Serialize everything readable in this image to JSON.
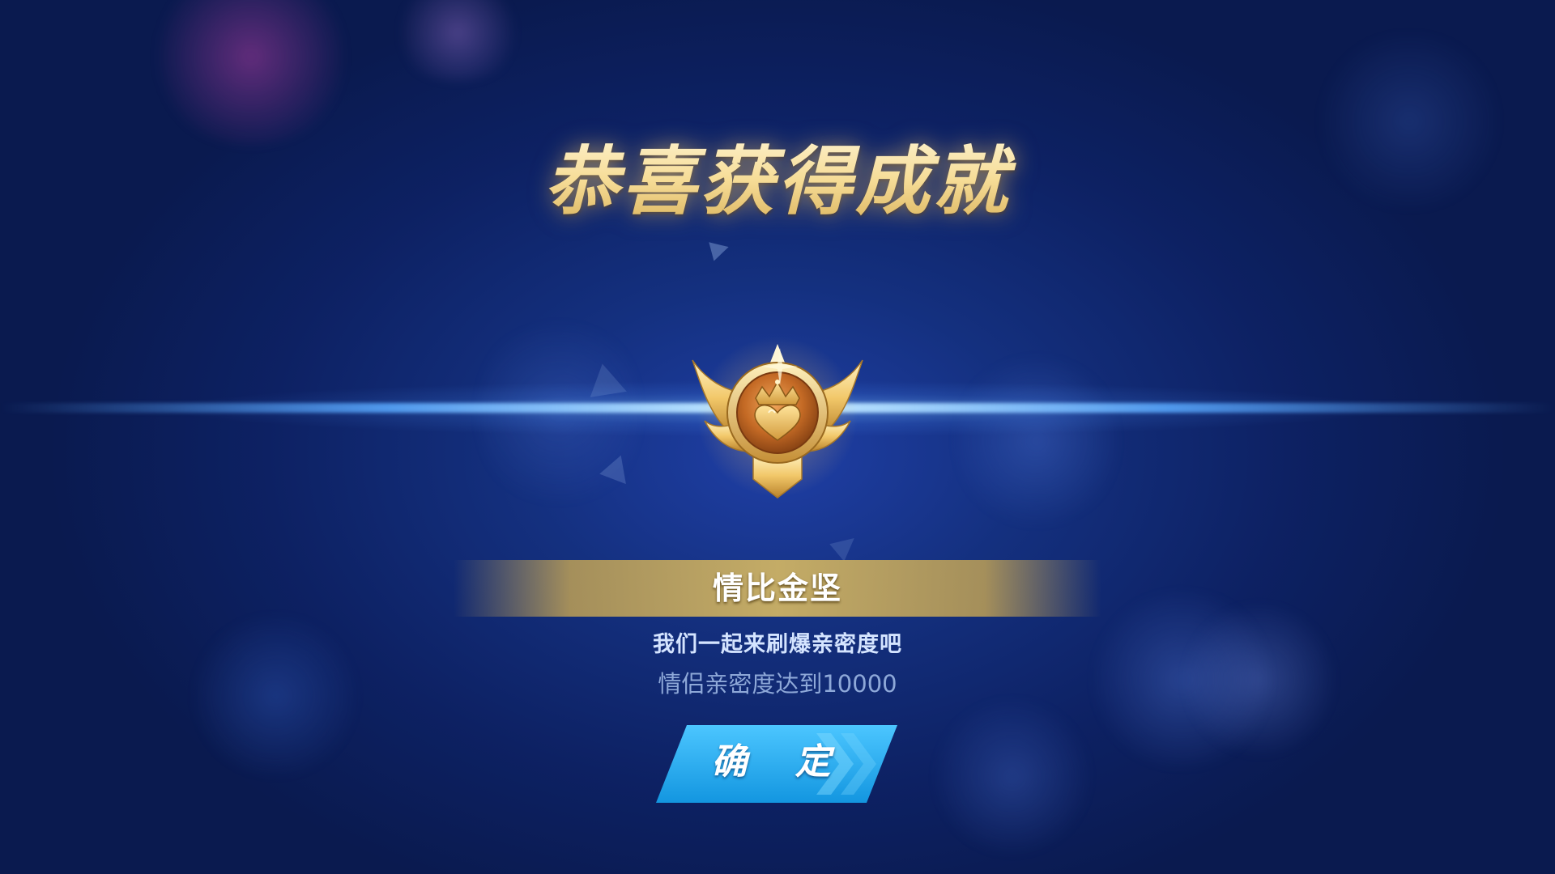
{
  "screen": {
    "title": "恭喜获得成就"
  },
  "achievement": {
    "name": "情比金坚",
    "description": "我们一起来刷爆亲密度吧",
    "condition": "情侣亲密度达到10000",
    "badge_icon": "gold-heart-crown-badge-icon"
  },
  "actions": {
    "confirm_label": "确 定"
  },
  "colors": {
    "background": "#0d2163",
    "title_gold": "#f6dc96",
    "banner_gold": "#cdb264",
    "button_blue": "#1aa8ec",
    "beam": "#c8ebff"
  }
}
